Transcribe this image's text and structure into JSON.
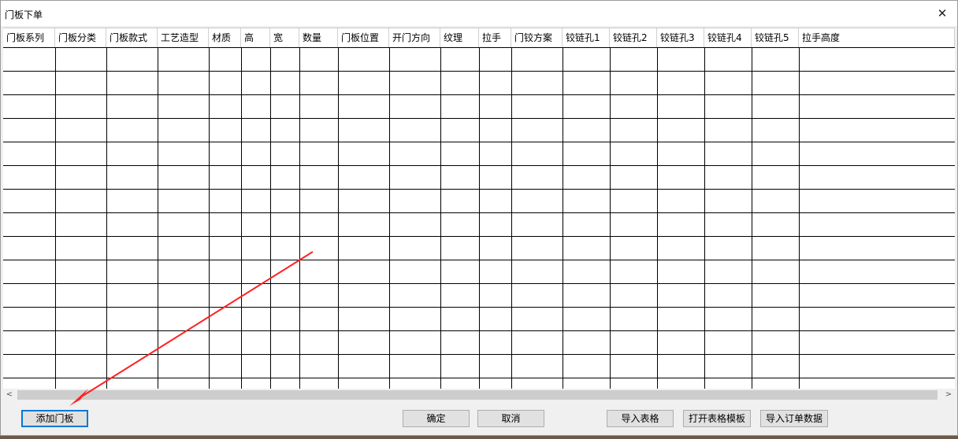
{
  "window": {
    "title": "门板下单",
    "close_glyph": "✕"
  },
  "table": {
    "columns": [
      "门板系列",
      "门板分类",
      "门板款式",
      "工艺造型",
      "材质",
      "高",
      "宽",
      "数量",
      "门板位置",
      "开门方向",
      "纹理",
      "拉手",
      "门铰方案",
      "铰链孔1",
      "铰链孔2",
      "铰链孔3",
      "铰链孔4",
      "铰链孔5",
      "拉手高度"
    ],
    "row_count": 14
  },
  "scrollbar": {
    "left_glyph": "<",
    "right_glyph": ">"
  },
  "buttons": {
    "add_door": "添加门板",
    "ok": "确定",
    "cancel": "取消",
    "import_table": "导入表格",
    "open_template": "打开表格模板",
    "import_order": "导入订单数据"
  },
  "annotation": {
    "color": "#ff2020"
  }
}
